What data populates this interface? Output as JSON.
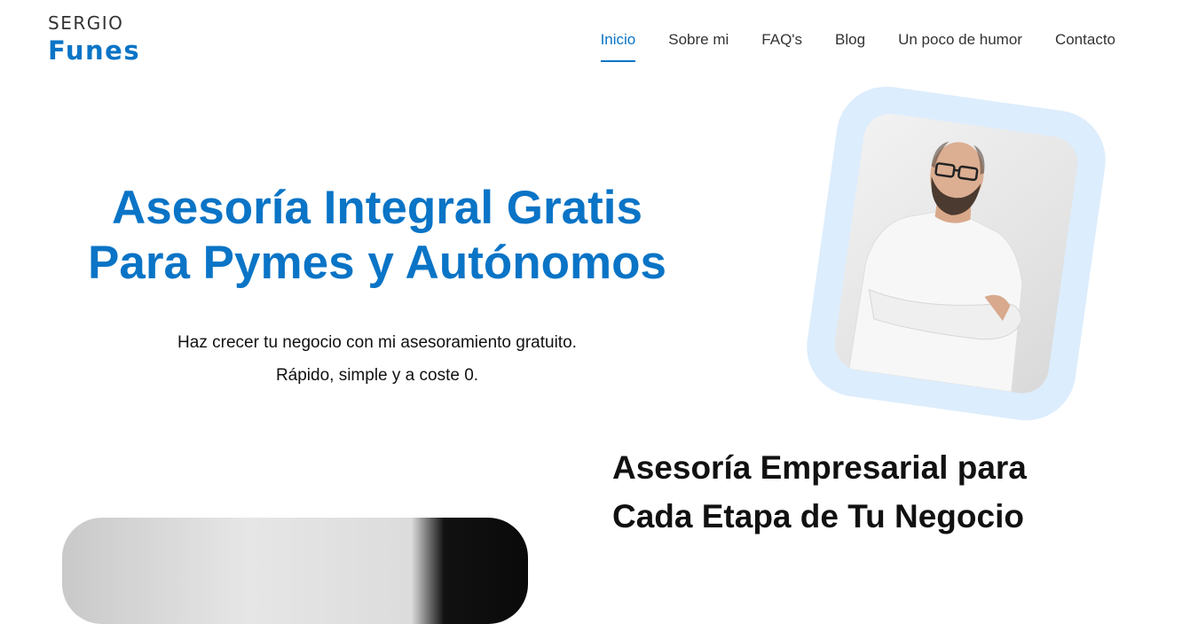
{
  "brand": {
    "top": "SERGIO",
    "bottom": "Funes"
  },
  "nav": {
    "items": [
      {
        "label": "Inicio",
        "active": true
      },
      {
        "label": "Sobre mi",
        "active": false
      },
      {
        "label": "FAQ's",
        "active": false
      },
      {
        "label": "Blog",
        "active": false
      },
      {
        "label": "Un poco de humor",
        "active": false
      },
      {
        "label": "Contacto",
        "active": false
      }
    ]
  },
  "hero": {
    "title_line1": "Asesoría Integral Gratis",
    "title_line2": "Para Pymes y Autónomos",
    "subtitle_line1": "Haz crecer tu negocio con mi asesoramiento gratuito.",
    "subtitle_line2": "Rápido, simple y a coste 0."
  },
  "section2": {
    "title_line1": "Asesoría Empresarial para",
    "title_line2": "Cada Etapa de Tu Negocio"
  },
  "colors": {
    "accent": "#0a74c6",
    "photo_frame": "#dcedfd"
  }
}
